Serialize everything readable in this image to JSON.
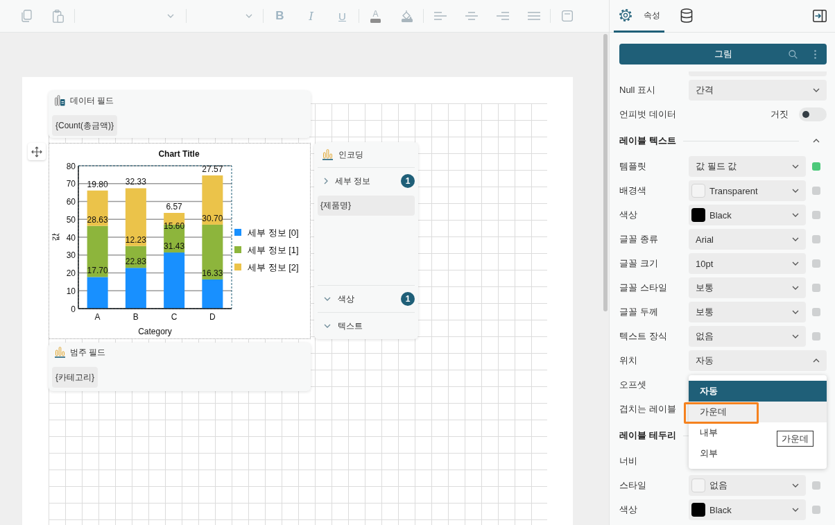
{
  "toolbar": {
    "disabled": true,
    "format_glyphs": [
      "B",
      "I",
      "U"
    ],
    "font_color_glyph": "A"
  },
  "designer": {
    "data_field": {
      "title": "데이터 필드",
      "chips": [
        "{Count(총금액)}"
      ]
    },
    "chart": {
      "chart_data": {
        "type": "bar",
        "stacked": true,
        "title": "Chart Title",
        "xlabel": "Category",
        "ylabel": "값",
        "categories": [
          "A",
          "B",
          "C",
          "D"
        ],
        "ylim": [
          0,
          80
        ],
        "yticks": [
          0,
          10,
          20,
          30,
          40,
          50,
          60,
          70,
          80
        ],
        "grid": true,
        "legend": true,
        "series": [
          {
            "name": "세부 정보 [0]",
            "color": "#1890ff",
            "values": [
              17.7,
              22.83,
              31.43,
              16.33
            ]
          },
          {
            "name": "세부 정보 [1]",
            "color": "#8db53c",
            "values": [
              28.63,
              12.23,
              15.6,
              30.7
            ]
          },
          {
            "name": "세부 정보 [2]",
            "color": "#ebc34a",
            "values": [
              19.8,
              32.33,
              6.57,
              27.57
            ]
          }
        ],
        "value_labels": [
          [
            "17.70",
            "22.83",
            "31.43",
            "16.33"
          ],
          [
            "28.63",
            "12.23",
            "15.60",
            "30.70"
          ],
          [
            "19.80",
            "32.33",
            "6.57",
            "27.57"
          ]
        ]
      }
    },
    "category_field": {
      "title": "범주 필드",
      "chips": [
        "{카테고리}"
      ]
    },
    "encoding": {
      "title": "인코딩",
      "groups": [
        {
          "label": "세부 정보",
          "expanded": false,
          "count": "1",
          "fields": [
            "{제품명}"
          ]
        },
        {
          "label": "색상",
          "expanded": true,
          "count": "1"
        },
        {
          "label": "텍스트",
          "expanded": true
        }
      ]
    }
  },
  "side_tabs": [
    {
      "kind": "properties",
      "label": "속성",
      "selected": true
    },
    {
      "kind": "data",
      "selected": false
    }
  ],
  "properties": {
    "title": "그림",
    "rows": [
      {
        "kind": "clipped"
      },
      {
        "kind": "select",
        "label": "Null 표시",
        "value": "간격"
      },
      {
        "kind": "toggle",
        "label": "언피벗 데이터",
        "value": "거짓",
        "on": false
      },
      {
        "kind": "section",
        "label": "레이블 텍스트",
        "expanded": true
      },
      {
        "kind": "select",
        "label": "템플릿",
        "value": "값 필드 값",
        "bound": true
      },
      {
        "kind": "color",
        "label": "배경색",
        "value": "Transparent",
        "bound": false
      },
      {
        "kind": "color",
        "label": "색상",
        "value": "Black",
        "color": "#000000",
        "bound": false
      },
      {
        "kind": "select",
        "label": "글꼴 종류",
        "value": "Arial",
        "bound": false
      },
      {
        "kind": "select",
        "label": "글꼴 크기",
        "value": "10pt",
        "bound": false
      },
      {
        "kind": "select",
        "label": "글꼴 스타일",
        "value": "보통",
        "bound": false
      },
      {
        "kind": "select",
        "label": "글꼴 두께",
        "value": "보통",
        "bound": false
      },
      {
        "kind": "select",
        "label": "텍스트 장식",
        "value": "없음",
        "bound": false
      },
      {
        "kind": "select",
        "label": "위치",
        "value": "자동",
        "expanded": true,
        "options": [
          {
            "label": "자동",
            "selected": true,
            "highlighted": false
          },
          {
            "label": "가운데",
            "selected": false,
            "highlighted": true
          },
          {
            "label": "내부",
            "selected": false,
            "highlighted": false
          },
          {
            "label": "외부",
            "selected": false,
            "highlighted": false
          }
        ],
        "tooltip": "가운데"
      },
      {
        "kind": "label",
        "label": "오프셋"
      },
      {
        "kind": "label",
        "label": "겹치는 레이블"
      },
      {
        "kind": "section",
        "label": "레이블 테두리"
      },
      {
        "kind": "label",
        "label": "너비"
      },
      {
        "kind": "color",
        "label": "스타일",
        "value": "없음",
        "bound": false
      },
      {
        "kind": "color",
        "label": "색상",
        "value": "Black",
        "color": "#000000",
        "bound": false
      }
    ]
  }
}
